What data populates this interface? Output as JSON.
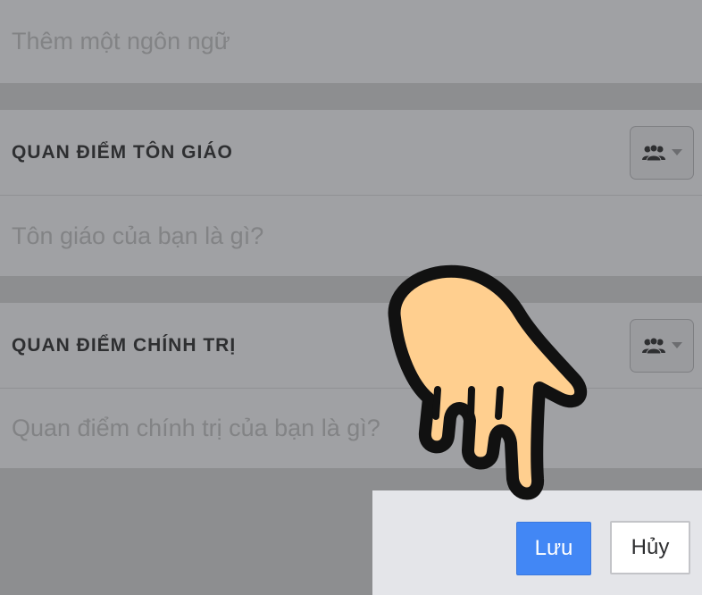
{
  "sections": {
    "language": {
      "placeholder": "Thêm một ngôn ngữ"
    },
    "religion": {
      "title": "QUAN ĐIỂM TÔN GIÁO",
      "placeholder": "Tôn giáo của bạn là gì?",
      "privacy_icon": "friends-icon"
    },
    "politics": {
      "title": "QUAN ĐIỂM CHÍNH TRỊ",
      "placeholder": "Quan điểm chính trị của bạn là gì?",
      "privacy_icon": "friends-icon"
    }
  },
  "actions": {
    "save_label": "Lưu",
    "cancel_label": "Hủy"
  },
  "colors": {
    "accent": "#4287f5",
    "overlay": "#8d8e90",
    "hand_fill": "#ffcf8f"
  }
}
